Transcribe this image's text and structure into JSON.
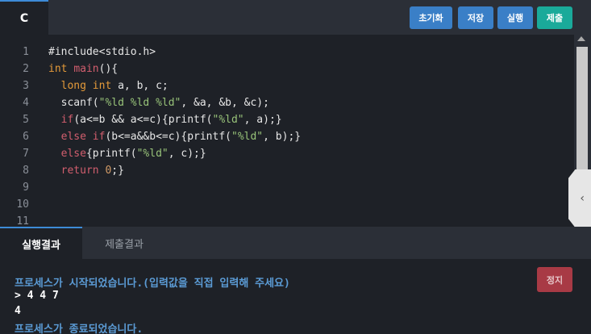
{
  "editor_tab": {
    "language": "C"
  },
  "toolbar": {
    "reset_label": "초기화",
    "save_label": "저장",
    "run_label": "실행",
    "submit_label": "제출"
  },
  "code": {
    "line_numbers": [
      "1",
      "2",
      "3",
      "4",
      "5",
      "6",
      "7",
      "8",
      "9",
      "10",
      "11"
    ],
    "lines": [
      [
        {
          "t": "#include<stdio.h>",
          "c": "fn"
        }
      ],
      [
        {
          "t": "int",
          "c": "ty"
        },
        {
          "t": " ",
          "c": "fn"
        },
        {
          "t": "main",
          "c": "kw"
        },
        {
          "t": "(){",
          "c": "fn"
        }
      ],
      [
        {
          "t": "  ",
          "c": "fn"
        },
        {
          "t": "long",
          "c": "ty"
        },
        {
          "t": " ",
          "c": "fn"
        },
        {
          "t": "int",
          "c": "ty"
        },
        {
          "t": " a, b, c;",
          "c": "fn"
        }
      ],
      [
        {
          "t": "  scanf(",
          "c": "fn"
        },
        {
          "t": "\"%ld %ld %ld\"",
          "c": "st"
        },
        {
          "t": ", &a, &b, &c);",
          "c": "fn"
        }
      ],
      [
        {
          "t": "  ",
          "c": "fn"
        },
        {
          "t": "if",
          "c": "kw"
        },
        {
          "t": "(a<=b && a<=c){printf(",
          "c": "fn"
        },
        {
          "t": "\"%ld\"",
          "c": "st"
        },
        {
          "t": ", a);}",
          "c": "fn"
        }
      ],
      [
        {
          "t": "  ",
          "c": "fn"
        },
        {
          "t": "else",
          "c": "kw"
        },
        {
          "t": " ",
          "c": "fn"
        },
        {
          "t": "if",
          "c": "kw"
        },
        {
          "t": "(b<=a&&b<=c){printf(",
          "c": "fn"
        },
        {
          "t": "\"%ld\"",
          "c": "st"
        },
        {
          "t": ", b);}",
          "c": "fn"
        }
      ],
      [
        {
          "t": "  ",
          "c": "fn"
        },
        {
          "t": "else",
          "c": "kw"
        },
        {
          "t": "{printf(",
          "c": "fn"
        },
        {
          "t": "\"%ld\"",
          "c": "st"
        },
        {
          "t": ", c);}",
          "c": "fn"
        }
      ],
      [
        {
          "t": "  ",
          "c": "fn"
        },
        {
          "t": "return",
          "c": "kw"
        },
        {
          "t": " ",
          "c": "fn"
        },
        {
          "t": "0",
          "c": "nm"
        },
        {
          "t": ";}",
          "c": "fn"
        }
      ],
      [
        {
          "t": "",
          "c": "fn"
        }
      ],
      [
        {
          "t": "",
          "c": "fn"
        }
      ],
      [
        {
          "t": "",
          "c": "fn"
        }
      ]
    ]
  },
  "result_tabs": {
    "run_result": "실행결과",
    "submit_result": "제출결과"
  },
  "console": {
    "started": "프로세스가 시작되었습니다.(입력값을 직접 입력해 주세요)",
    "input": "> 4 4 7",
    "output": "4",
    "ended": "프로세스가 종료되었습니다.",
    "stop_label": "정지"
  },
  "icons": {
    "collapse": "chevron-left-icon"
  },
  "colors": {
    "accent": "#3a7fc7",
    "submit": "#1aaa9a",
    "stop": "#a83a45",
    "console_info": "#5b9bd5"
  }
}
